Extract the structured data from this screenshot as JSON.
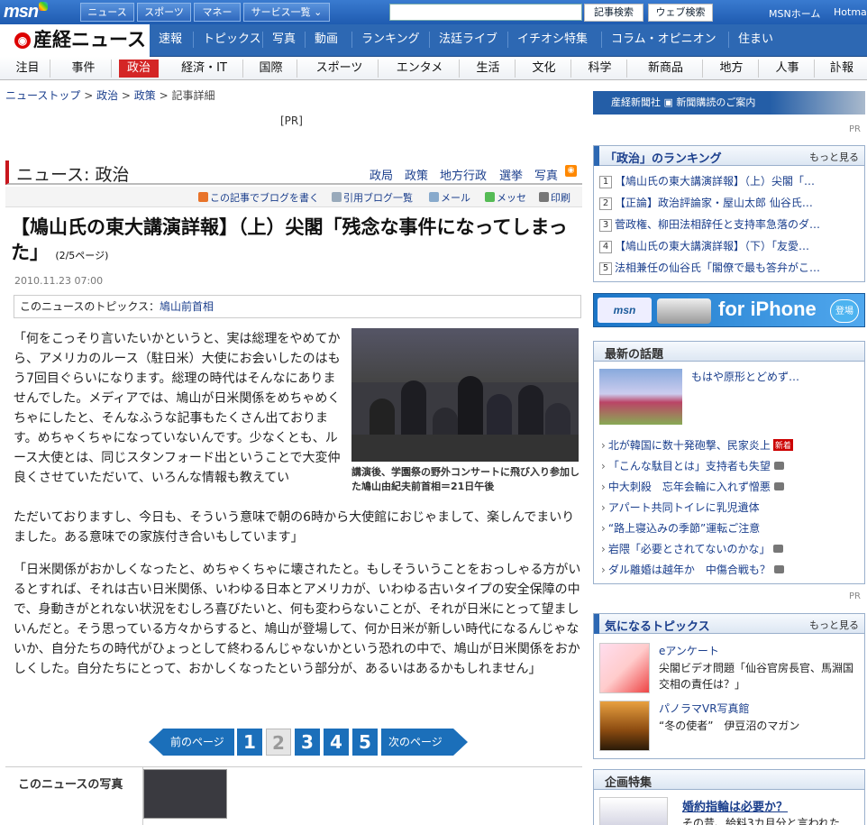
{
  "msn": {
    "logo": "msn",
    "nav": [
      "ニュース",
      "スポーツ",
      "マネー",
      "サービス一覧 ⌄"
    ],
    "search_placeholder": "",
    "btn_news_search": "記事検索",
    "btn_web_search": "ウェブ検索",
    "home_link": "MSNホーム",
    "hotmail_link": "Hotmail"
  },
  "sankei": {
    "logo": "産経ニュース",
    "nav": [
      "速報",
      "トピックス",
      "写真",
      "動画",
      "ランキング",
      "法廷ライブ",
      "イチオシ特集",
      "コラム・オピニオン",
      "住まい"
    ]
  },
  "categories": [
    "注目",
    "事件",
    "政治",
    "経済・IT",
    "国際",
    "スポーツ",
    "エンタメ",
    "生活",
    "文化",
    "科学",
    "新商品",
    "地方",
    "人事",
    "訃報"
  ],
  "breadcrumb": {
    "items": [
      "ニューストップ",
      "政治",
      "政策"
    ],
    "current": "記事詳細",
    "sep": " > "
  },
  "pr_top": "[PR]",
  "section": {
    "title": "ニュース: 政治",
    "links": [
      "政局",
      "政策",
      "地方行政",
      "選挙",
      "写真"
    ]
  },
  "tools": [
    "この記事でブログを書く",
    "引用ブログ一覧",
    "メール",
    "メッセ",
    "印刷"
  ],
  "article": {
    "headline": "【鳩山氏の東大講演詳報】（上）尖閣「残念な事件になってしまった」",
    "page_indicator": "(2/5ページ)",
    "date": "2010.11.23 07:00",
    "topics_label": "このニュースのトピックス：",
    "topics_link": "鳩山前首相",
    "para1_a": "「何をこっそり言いたいかというと、実は総理をやめてから、アメリカのルース（駐日米）大使にお会いしたのはもう7回目ぐらいになります。総理の時代はそんなにありませんでした。メディアでは、鳩山が日米関係をめちゃめくちゃにしたと、そんなふうな記事もたくさん出ております。めちゃくちゃになっていないんです。少なくとも、ルース大使とは、同じスタンフォード出ということで大変仲良くさせていただいて、いろんな情報も教えてい",
    "para1_b": "ただいておりますし、今日も、そういう意味で朝の6時から大使館におじゃまして、楽しんでまいりました。ある意味での家族付き合いもしています」",
    "para2": "「日米関係がおかしくなったと、めちゃくちゃに壊されたと。もしそういうことをおっしゃる方がいるとすれば、それは古い日米関係、いわゆる日本とアメリカが、いわゆる古いタイプの安全保障の中で、身動きがとれない状況をむしろ喜びたいと、何も変わらないことが、それが日米にとって望ましいんだと。そう思っている方々からすると、鳩山が登場して、何か日米が新しい時代になるんじゃないか、自分たちの時代がひょっとして終わるんじゃないかという恐れの中で、鳩山が日米関係をおかしくした。自分たちにとって、おかしくなったという部分が、あるいはあるかもしれません」",
    "photo_caption": "講演後、学園祭の野外コンサートに飛び入り参加した鳩山由紀夫前首相＝21日午後"
  },
  "pager": {
    "prev": "前のページ",
    "next": "次のページ",
    "pages": [
      "1",
      "2",
      "3",
      "4",
      "5"
    ],
    "current": 2
  },
  "photo_strip": {
    "label": "このニュースの写真"
  },
  "right": {
    "banner": "産経新聞社  ▣ 新聞購読のご案内",
    "pr": "PR",
    "ranking": {
      "title": "「政治」のランキング",
      "more": "もっと見る",
      "items": [
        "【鳩山氏の東大講演詳報】（上）尖閣「…",
        "【正論】政治評論家・屋山太郎 仙谷氏…",
        "菅政権、柳田法相辞任と支持率急落のダ…",
        "【鳩山氏の東大講演詳報】（下）「友愛…",
        "法相兼任の仙谷氏「閣僚で最も答弁がこ…"
      ]
    },
    "iphone": {
      "msn": "msn",
      "text": "for iPhone",
      "badge": "登場"
    },
    "latest": {
      "title": "最新の話題",
      "featured": "もはや原形とどめず…",
      "items": [
        {
          "text": "北が韓国に数十発砲撃、民家炎上",
          "badge": "新着",
          "cam": false
        },
        {
          "text": "「こんな駄目とは」支持者も失望",
          "badge": "",
          "cam": true
        },
        {
          "text": "中大刺殺　忘年会輪に入れず憎悪",
          "badge": "",
          "cam": true
        },
        {
          "text": "アパート共同トイレに乳児遺体",
          "badge": "",
          "cam": false
        },
        {
          "text": "“路上寝込みの季節”運転ご注意",
          "badge": "",
          "cam": false
        },
        {
          "text": "岩隈「必要とされてないのかな」",
          "badge": "",
          "cam": true
        },
        {
          "text": "ダル離婚は越年か　中傷合戦も？",
          "badge": "",
          "cam": true
        }
      ]
    },
    "pr2": "PR",
    "topics": {
      "title": "気になるトピックス",
      "more": "もっと見る",
      "items": [
        {
          "title": "eアンケート",
          "desc": "尖閣ビデオ問題「仙谷官房長官、馬淵国交相の責任は？」"
        },
        {
          "title": "パノラマVR写真館",
          "desc": "“冬の使者”　伊豆沼のマガン"
        }
      ]
    },
    "special": {
      "title": "企画特集",
      "item_title": "婚約指輪は必要か？",
      "item_desc": "その昔、給料3カ月分と言われた"
    }
  }
}
